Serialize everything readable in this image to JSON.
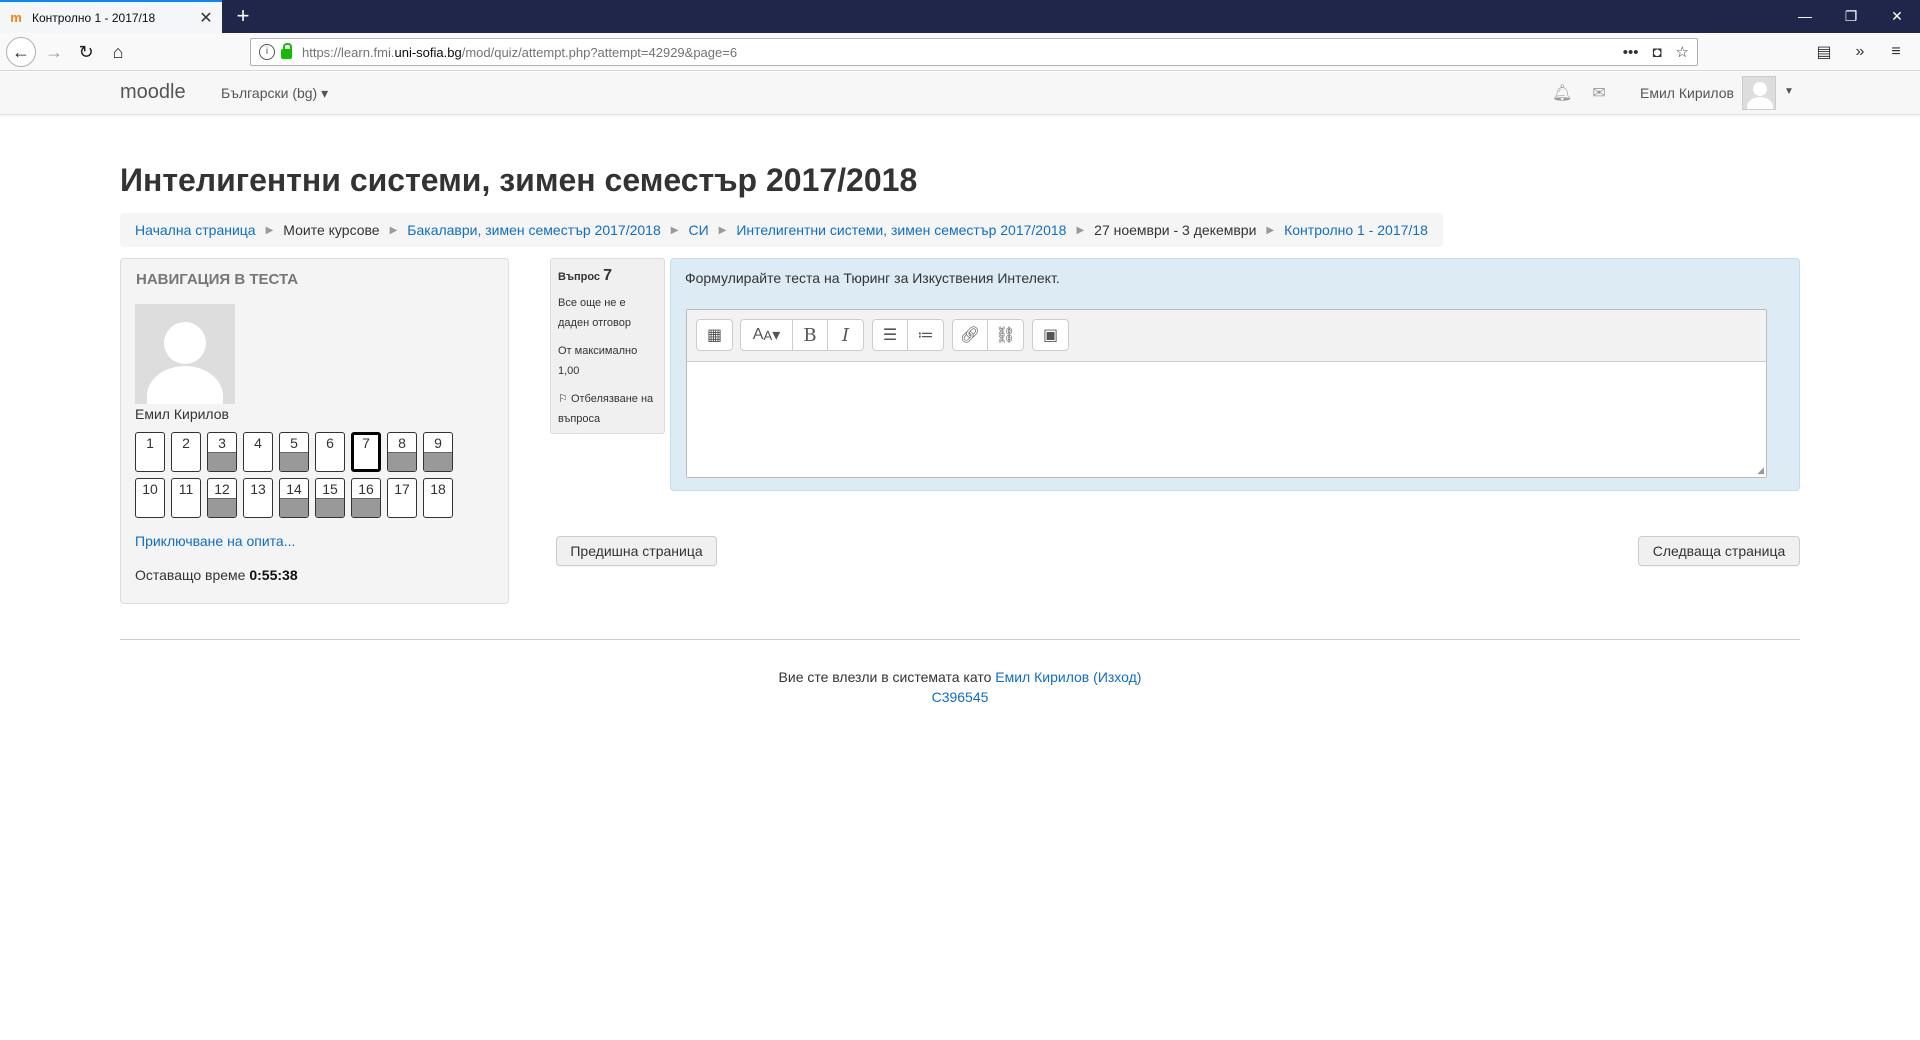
{
  "browser": {
    "tab_title": "Контролно 1 - 2017/18",
    "favicon": "m",
    "url_prefix": "https://learn.fmi.",
    "url_host": "uni-sofia.bg",
    "url_path": "/mod/quiz/attempt.php?attempt=42929&page=6"
  },
  "header": {
    "brand": "moodle",
    "language": "Български (bg)",
    "user_name": "Емил Кирилов"
  },
  "page": {
    "title": "Интелигентни системи, зимен семестър 2017/2018"
  },
  "breadcrumb": [
    {
      "label": "Начална страница",
      "link": true
    },
    {
      "label": "Моите курсове",
      "link": false
    },
    {
      "label": "Бакалаври, зимен семестър 2017/2018",
      "link": true
    },
    {
      "label": "СИ",
      "link": true
    },
    {
      "label": "Интелигентни системи, зимен семестър 2017/2018",
      "link": true
    },
    {
      "label": "27 ноември - 3 декември",
      "link": false
    },
    {
      "label": "Контролно 1 - 2017/18",
      "link": true
    }
  ],
  "quiz_nav": {
    "heading": "Навигация в теста",
    "user_name": "Емил Кирилов",
    "questions": [
      {
        "n": "1",
        "answered": false,
        "current": false
      },
      {
        "n": "2",
        "answered": false,
        "current": false
      },
      {
        "n": "3",
        "answered": true,
        "current": false
      },
      {
        "n": "4",
        "answered": false,
        "current": false
      },
      {
        "n": "5",
        "answered": true,
        "current": false
      },
      {
        "n": "6",
        "answered": false,
        "current": false
      },
      {
        "n": "7",
        "answered": false,
        "current": true
      },
      {
        "n": "8",
        "answered": true,
        "current": false
      },
      {
        "n": "9",
        "answered": true,
        "current": false
      },
      {
        "n": "10",
        "answered": false,
        "current": false
      },
      {
        "n": "11",
        "answered": false,
        "current": false
      },
      {
        "n": "12",
        "answered": true,
        "current": false
      },
      {
        "n": "13",
        "answered": false,
        "current": false
      },
      {
        "n": "14",
        "answered": true,
        "current": false
      },
      {
        "n": "15",
        "answered": true,
        "current": false
      },
      {
        "n": "16",
        "answered": true,
        "current": false
      },
      {
        "n": "17",
        "answered": false,
        "current": false
      },
      {
        "n": "18",
        "answered": false,
        "current": false
      }
    ],
    "finish_link": "Приключване на опита...",
    "time_label": "Оставащо време ",
    "time_value": "0:55:38"
  },
  "question": {
    "label": "Въпрос ",
    "number": "7",
    "status": "Все още не е даден отговор",
    "max_mark": "От максимално 1,00",
    "flag": "Отбелязване на въпроса",
    "text": "Формулирайте теста на Тюринг за Изкуствения Интелект.",
    "answer": ""
  },
  "nav_buttons": {
    "prev": "Предишна страница",
    "next": "Следваща страница"
  },
  "footer": {
    "logged_in_as": "Вие сте влезли в системата като ",
    "user": "Емил Кирилов",
    "logout": "Изход",
    "code": "С396545"
  },
  "colors": {
    "link": "#0f6fc5",
    "question_bg": "#dcebf4",
    "tab_bar": "#1f2649"
  }
}
